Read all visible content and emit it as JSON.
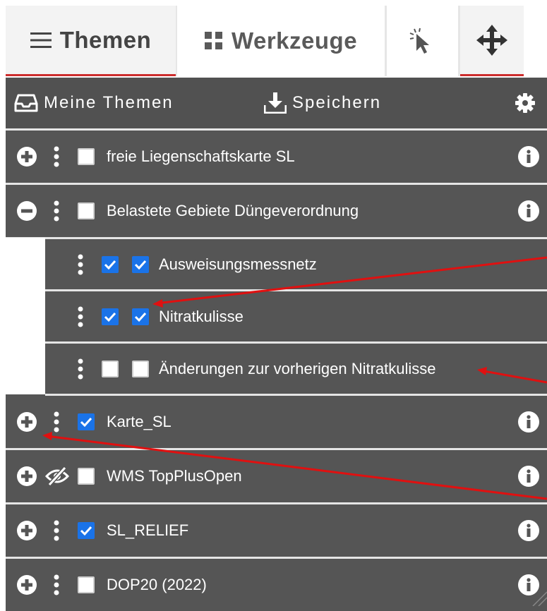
{
  "tabs": {
    "themen": "Themen",
    "werkzeuge": "Werkzeuge"
  },
  "toolbar": {
    "my_themes": "Meine Themen",
    "save": "Speichern"
  },
  "layers": {
    "l1": "freie Liegenschaftskarte SL",
    "l2": "Belastete Gebiete Düngeverordnung",
    "l2a": "Ausweisungsmessnetz",
    "l2b": "Nitratkulisse",
    "l2c": "Änderungen zur vorherigen Nitratkulisse",
    "l3": "Karte_SL",
    "l4": "WMS TopPlusOpen",
    "l5": "SL_RELIEF",
    "l6": "DOP20 (2022)"
  },
  "colors": {
    "panel": "#555555",
    "accent": "#cc2d2d",
    "checkbox": "#1a73e8",
    "arrow": "#e01010"
  }
}
